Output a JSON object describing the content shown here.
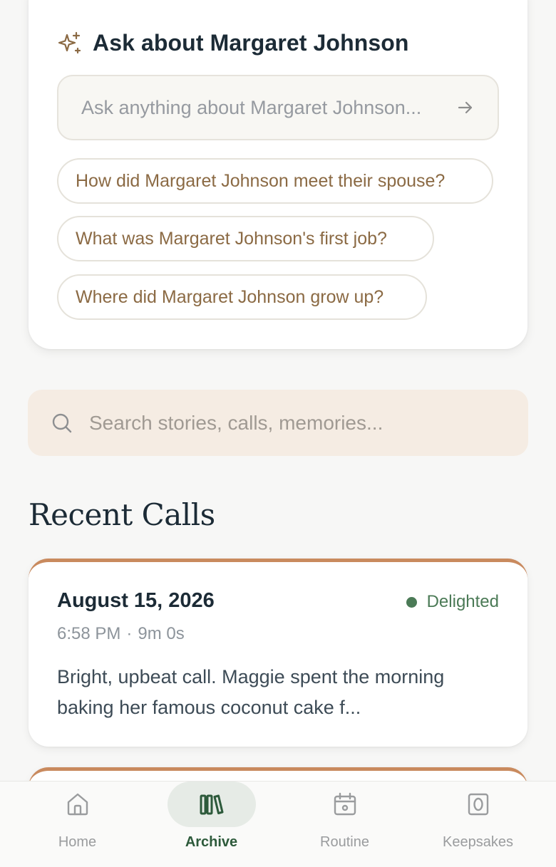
{
  "ask": {
    "title": "Ask about Margaret Johnson",
    "input_placeholder": "Ask anything about Margaret Johnson...",
    "suggestions": [
      "How did Margaret Johnson meet their spouse?",
      "What was Margaret Johnson's first job?",
      "Where did Margaret Johnson grow up?"
    ]
  },
  "search": {
    "placeholder": "Search stories, calls, memories..."
  },
  "recent_calls": {
    "title": "Recent Calls",
    "items": [
      {
        "date": "August 15, 2026",
        "mood": "Delighted",
        "time": "6:58 PM",
        "separator": "·",
        "duration": "9m 0s",
        "summary": "Bright, upbeat call. Maggie spent the morning baking her famous coconut cake f..."
      }
    ]
  },
  "nav": {
    "items": [
      {
        "label": "Home",
        "icon": "home-icon"
      },
      {
        "label": "Archive",
        "icon": "archive-icon",
        "active": true
      },
      {
        "label": "Routine",
        "icon": "calendar-icon"
      },
      {
        "label": "Keepsakes",
        "icon": "keepsakes-icon"
      }
    ]
  },
  "colors": {
    "accent_brown": "#8b6a44",
    "card_accent": "#c98a5e",
    "mood_green": "#4b7a56",
    "active_nav": "#2d5a3b",
    "search_bg": "#f5ece3"
  }
}
